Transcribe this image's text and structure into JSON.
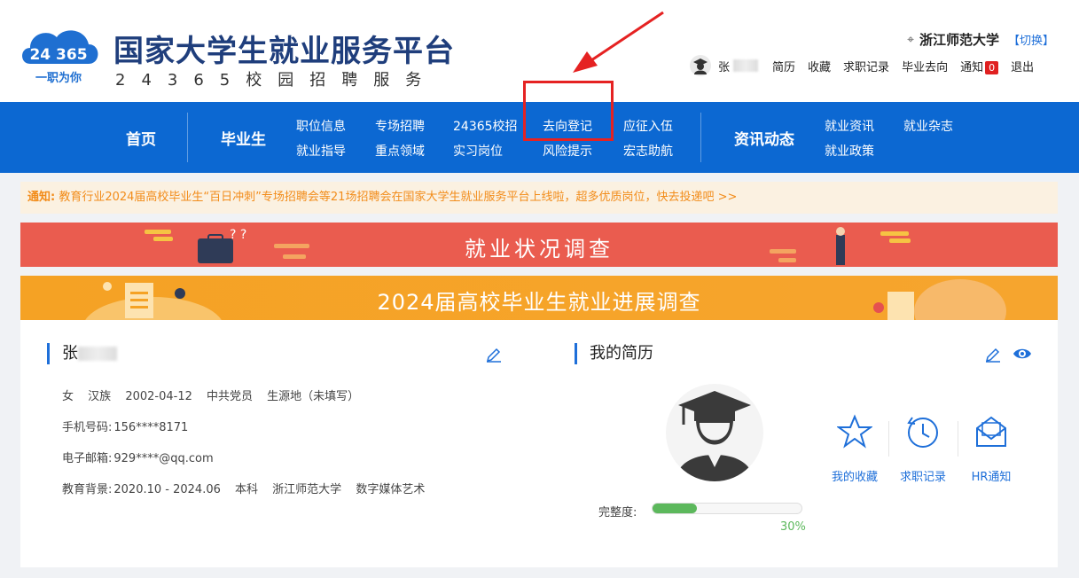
{
  "header": {
    "title": "国家大学生就业服务平台",
    "subtitle": "24365校园招聘服务",
    "logo_number": "24 365",
    "logo_slogan": "一职为你",
    "school_name": "浙江师范大学",
    "switch_label": "【切换】",
    "user_name": "张",
    "links": [
      "简历",
      "收藏",
      "求职记录",
      "毕业去向",
      "通知"
    ],
    "notice_count": "0",
    "logout": "退出"
  },
  "nav": {
    "home": "首页",
    "graduate": "毕业生",
    "sub_row1": [
      "职位信息",
      "专场招聘",
      "24365校招",
      "去向登记",
      "应征入伍"
    ],
    "sub_row2": [
      "就业指导",
      "重点领域",
      "实习岗位",
      "风险提示",
      "宏志助航"
    ],
    "news": "资讯动态",
    "news_row1": [
      "就业资讯",
      "就业杂志"
    ],
    "news_row2": [
      "就业政策"
    ]
  },
  "notice": {
    "label": "通知:",
    "text": "教育行业2024届高校毕业生“百日冲刺”专场招聘会等21场招聘会在国家大学生就业服务平台上线啦，超多优质岗位，快去投递吧 >>"
  },
  "banners": {
    "survey": "就业状况调查",
    "progress": "2024届高校毕业生就业进展调查"
  },
  "profile": {
    "name": "张",
    "gender": "女",
    "ethnicity": "汉族",
    "birth": "2002-04-12",
    "politics": "中共党员",
    "origin": "生源地（未填写）",
    "phone_label": "手机号码:",
    "phone": "156****8171",
    "email_label": "电子邮箱:",
    "email": "929****@qq.com",
    "edu_label": "教育背景:",
    "edu_period": "2020.10 - 2024.06",
    "degree": "本科",
    "school": "浙江师范大学",
    "major": "数字媒体艺术"
  },
  "resume": {
    "title": "我的简历",
    "quick_links": [
      "我的收藏",
      "求职记录",
      "HR通知"
    ],
    "completeness_label": "完整度:",
    "completeness": 0.3,
    "completeness_text": "30%"
  },
  "colors": {
    "brand_blue": "#0c68d2",
    "banner_red": "#ea5c4f",
    "banner_orange": "#f5a224",
    "highlight_red": "#e52222",
    "progress_green": "#5cb85c"
  }
}
